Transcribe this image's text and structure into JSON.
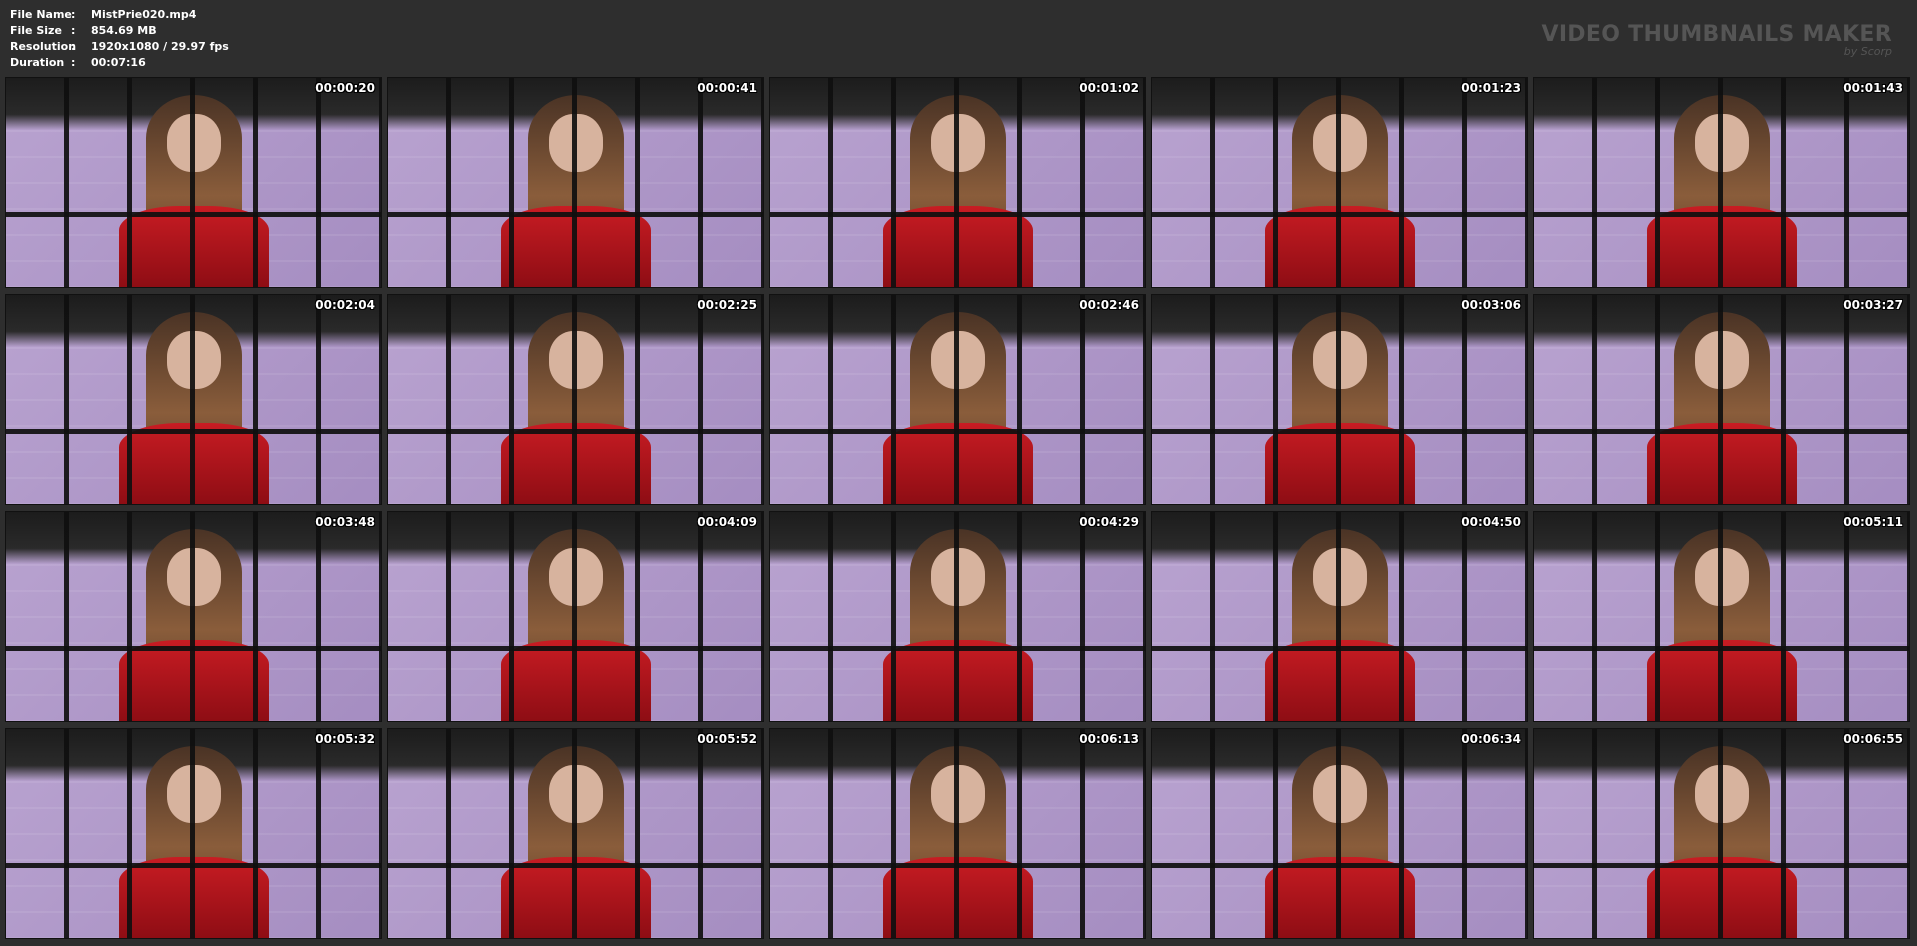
{
  "info": {
    "file_name_label": "File Name",
    "file_name": "MistPrie020.mp4",
    "file_size_label": "File Size",
    "file_size": "854.69 MB",
    "resolution_label": "Resolution",
    "resolution": "1920x1080 / 29.97 fps",
    "duration_label": "Duration",
    "duration": "00:07:16",
    "separator": ":"
  },
  "brand": {
    "title": "VIDEO THUMBNAILS MAKER",
    "byline": "by Scorp"
  },
  "thumbnails": [
    {
      "timestamp": "00:00:20"
    },
    {
      "timestamp": "00:00:41"
    },
    {
      "timestamp": "00:01:02"
    },
    {
      "timestamp": "00:01:23"
    },
    {
      "timestamp": "00:01:43"
    },
    {
      "timestamp": "00:02:04"
    },
    {
      "timestamp": "00:02:25"
    },
    {
      "timestamp": "00:02:46"
    },
    {
      "timestamp": "00:03:06"
    },
    {
      "timestamp": "00:03:27"
    },
    {
      "timestamp": "00:03:48"
    },
    {
      "timestamp": "00:04:09"
    },
    {
      "timestamp": "00:04:29"
    },
    {
      "timestamp": "00:04:50"
    },
    {
      "timestamp": "00:05:11"
    },
    {
      "timestamp": "00:05:32"
    },
    {
      "timestamp": "00:05:52"
    },
    {
      "timestamp": "00:06:13"
    },
    {
      "timestamp": "00:06:34"
    },
    {
      "timestamp": "00:06:55"
    }
  ]
}
